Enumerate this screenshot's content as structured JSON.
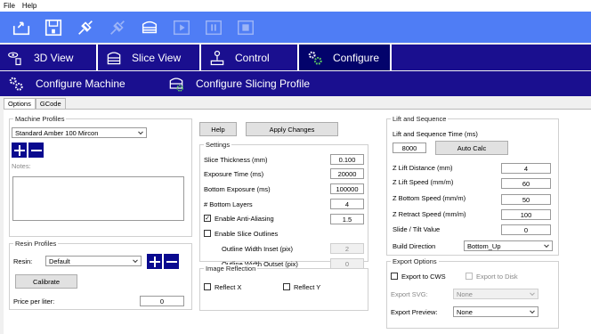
{
  "menu": {
    "file": "File",
    "help": "Help"
  },
  "main_tabs": [
    {
      "label": "3D View"
    },
    {
      "label": "Slice View"
    },
    {
      "label": "Control"
    },
    {
      "label": "Configure"
    }
  ],
  "config_tabs": [
    {
      "label": "Configure Machine"
    },
    {
      "label": "Configure Slicing Profile"
    }
  ],
  "sub_tabs": {
    "options": "Options",
    "gcode": "GCode"
  },
  "machine_profiles": {
    "group_label": "Machine Profiles",
    "selected": "Standard Amber 100 Mircon",
    "notes_label": "Notes:"
  },
  "resin_profiles": {
    "group_label": "Resin Profiles",
    "resin_label": "Resin:",
    "resin_selected": "Default",
    "calibrate_label": "Calibrate",
    "price_label": "Price per liter:",
    "price_value": "0"
  },
  "actions": {
    "help": "Help",
    "apply": "Apply Changes"
  },
  "settings": {
    "group_label": "Settings",
    "slice_thickness_label": "Slice Thickness (mm)",
    "slice_thickness": "0.100",
    "exposure_time_label": "Exposure Time (ms)",
    "exposure_time": "20000",
    "bottom_exposure_label": "Bottom Exposure (ms)",
    "bottom_exposure": "100000",
    "bottom_layers_label": "# Bottom Layers",
    "bottom_layers": "4",
    "anti_aliasing_label": "Enable Anti-Aliasing",
    "anti_aliasing_value": "1.5",
    "anti_aliasing_checked": "✓",
    "slice_outlines_label": "Enable Slice Outlines",
    "outline_inset_label": "Outline Width Inset (pix)",
    "outline_inset": "2",
    "outline_outset_label": "Outline Width Outset (pix)",
    "outline_outset": "0"
  },
  "image_reflection": {
    "group_label": "Image Reflection",
    "reflect_x": "Reflect X",
    "reflect_y": "Reflect Y"
  },
  "lift": {
    "group_label": "Lift and Sequence",
    "seq_time_label": "Lift and Sequence Time (ms)",
    "seq_time": "8000",
    "auto_calc": "Auto Calc",
    "z_lift_distance_label": "Z Lift Distance (mm)",
    "z_lift_distance": "4",
    "z_lift_speed_label": "Z Lift Speed (mm/m)",
    "z_lift_speed": "60",
    "z_bottom_speed_label": "Z Bottom Speed (mm/m)",
    "z_bottom_speed": "50",
    "z_retract_speed_label": "Z Retract Speed (mm/m)",
    "z_retract_speed": "100",
    "slide_tilt_label": "Slide / Tilt Value",
    "slide_tilt": "0",
    "build_direction_label": "Build Direction",
    "build_direction": "Bottom_Up"
  },
  "export": {
    "group_label": "Export Options",
    "export_cws": "Export to CWS",
    "export_disk": "Export to Disk",
    "export_svg_label": "Export SVG:",
    "export_svg_value": "None",
    "export_preview_label": "Export Preview:",
    "export_preview_value": "None"
  },
  "colors": {
    "toolbar": "#4f7df5",
    "tab_bar": "#1a0f8f",
    "accent_square": "#0a0a8f"
  }
}
